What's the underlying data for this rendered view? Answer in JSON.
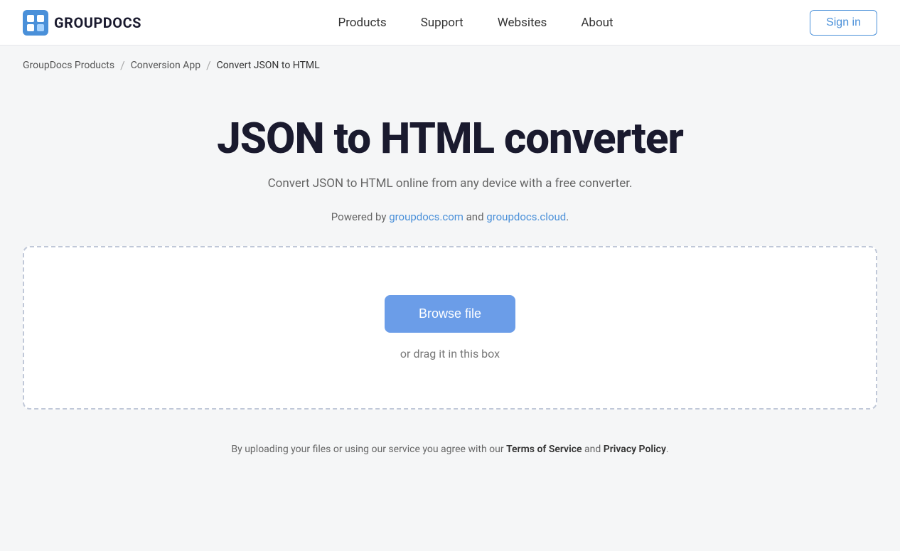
{
  "header": {
    "logo_text": "GROUPDOCS",
    "nav_items": [
      {
        "label": "Products",
        "href": "#"
      },
      {
        "label": "Support",
        "href": "#"
      },
      {
        "label": "Websites",
        "href": "#"
      },
      {
        "label": "About",
        "href": "#"
      }
    ],
    "signin_label": "Sign in"
  },
  "breadcrumb": {
    "items": [
      {
        "label": "GroupDocs Products",
        "href": "#"
      },
      {
        "label": "Conversion App",
        "href": "#"
      },
      {
        "label": "Convert JSON to HTML",
        "href": null
      }
    ],
    "separator": "/"
  },
  "main": {
    "title": "JSON to HTML converter",
    "subtitle": "Convert JSON to HTML online from any device with a free converter.",
    "powered_by_prefix": "Powered by ",
    "powered_by_link1_text": "groupdocs.com",
    "powered_by_link1_href": "#",
    "powered_by_and": " and ",
    "powered_by_link2_text": "groupdocs.cloud",
    "powered_by_link2_href": "#",
    "powered_by_suffix": ".",
    "upload_box": {
      "browse_btn_label": "Browse file",
      "drag_text": "or drag it in this box"
    },
    "footer_note_prefix": "By uploading your files or using our service you agree with our ",
    "footer_note_tos": "Terms of Service",
    "footer_note_and": " and ",
    "footer_note_privacy": "Privacy Policy",
    "footer_note_suffix": "."
  }
}
